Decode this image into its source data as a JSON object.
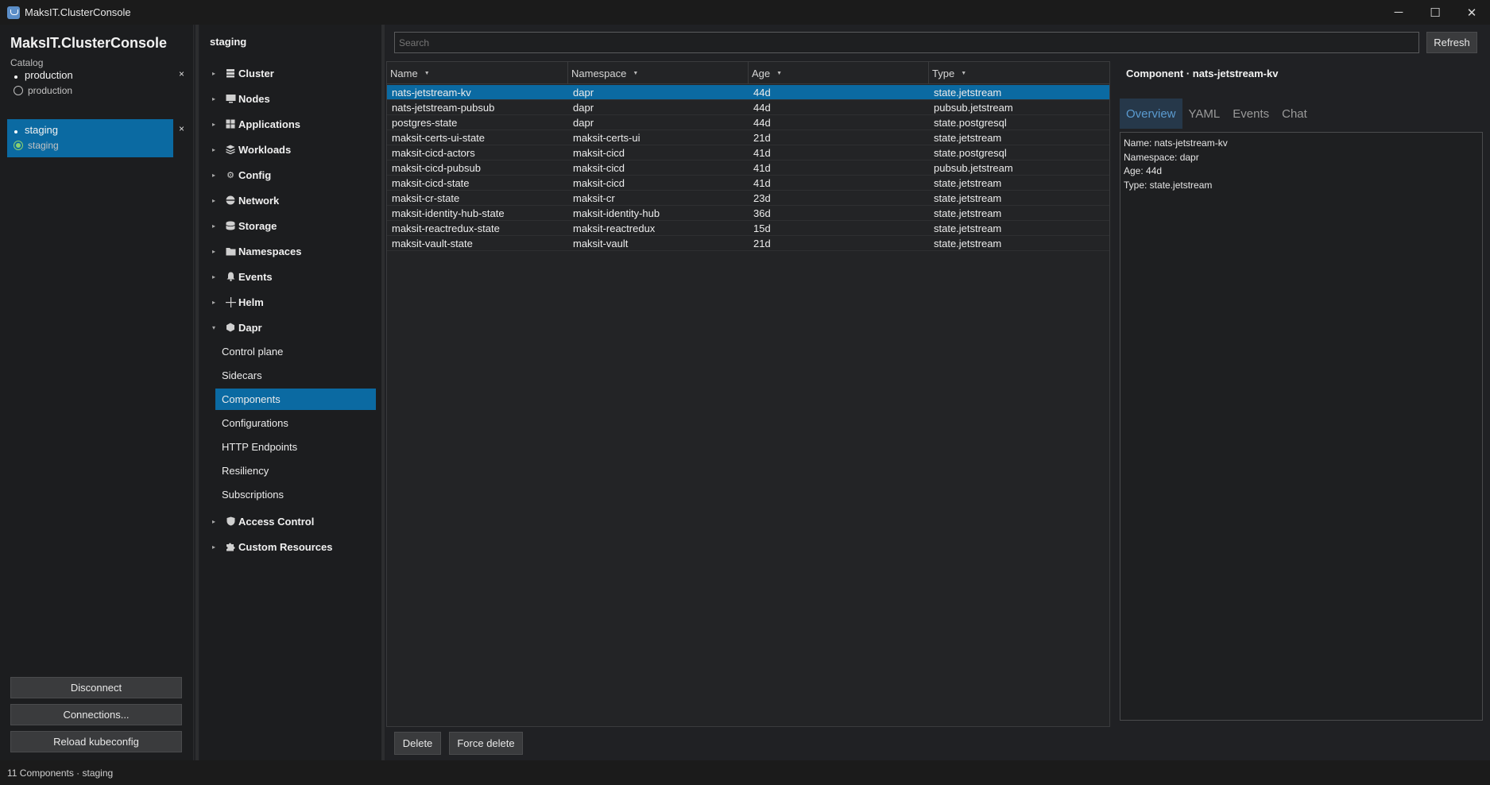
{
  "window": {
    "title": "MaksIT.ClusterConsole",
    "controls": {
      "minimize": "─",
      "maximize": "☐",
      "close": "✕"
    }
  },
  "catalog": {
    "title": "MaksIT.ClusterConsole",
    "subtitle": "Catalog",
    "connections": [
      {
        "name": "production",
        "context": "production",
        "selected": false
      },
      {
        "name": "staging",
        "context": "staging",
        "selected": true
      }
    ],
    "close_glyph": "×",
    "buttons": {
      "disconnect": "Disconnect",
      "connections": "Connections...",
      "reload": "Reload kubeconfig"
    }
  },
  "tree": {
    "header": "staging",
    "nodes": [
      {
        "label": "Cluster",
        "icon": "server-icon"
      },
      {
        "label": "Nodes",
        "icon": "monitor-icon"
      },
      {
        "label": "Applications",
        "icon": "grid-icon"
      },
      {
        "label": "Workloads",
        "icon": "layers-icon"
      },
      {
        "label": "Config",
        "icon": "gear-icon"
      },
      {
        "label": "Network",
        "icon": "network-icon"
      },
      {
        "label": "Storage",
        "icon": "database-icon"
      },
      {
        "label": "Namespaces",
        "icon": "folder-icon"
      },
      {
        "label": "Events",
        "icon": "bell-icon"
      },
      {
        "label": "Helm",
        "icon": "helm-icon"
      },
      {
        "label": "Dapr",
        "icon": "hexagon-icon"
      }
    ],
    "dapr_children": [
      "Control plane",
      "Sidecars",
      "Components",
      "Configurations",
      "HTTP Endpoints",
      "Resiliency",
      "Subscriptions"
    ],
    "selected_child": "Components",
    "after_nodes": [
      {
        "label": "Access Control",
        "icon": "shield-icon"
      },
      {
        "label": "Custom Resources",
        "icon": "puzzle-icon"
      }
    ]
  },
  "search": {
    "placeholder": "Search",
    "value": ""
  },
  "refresh_label": "Refresh",
  "grid": {
    "columns": [
      "Name",
      "Namespace",
      "Age",
      "Type"
    ],
    "sort_glyph": "▼",
    "rows": [
      [
        "nats-jetstream-kv",
        "dapr",
        "44d",
        "state.jetstream"
      ],
      [
        "nats-jetstream-pubsub",
        "dapr",
        "44d",
        "pubsub.jetstream"
      ],
      [
        "postgres-state",
        "dapr",
        "44d",
        "state.postgresql"
      ],
      [
        "maksit-certs-ui-state",
        "maksit-certs-ui",
        "21d",
        "state.jetstream"
      ],
      [
        "maksit-cicd-actors",
        "maksit-cicd",
        "41d",
        "state.postgresql"
      ],
      [
        "maksit-cicd-pubsub",
        "maksit-cicd",
        "41d",
        "pubsub.jetstream"
      ],
      [
        "maksit-cicd-state",
        "maksit-cicd",
        "41d",
        "state.jetstream"
      ],
      [
        "maksit-cr-state",
        "maksit-cr",
        "23d",
        "state.jetstream"
      ],
      [
        "maksit-identity-hub-state",
        "maksit-identity-hub",
        "36d",
        "state.jetstream"
      ],
      [
        "maksit-reactredux-state",
        "maksit-reactredux",
        "15d",
        "state.jetstream"
      ],
      [
        "maksit-vault-state",
        "maksit-vault",
        "21d",
        "state.jetstream"
      ]
    ],
    "selected_row": 0
  },
  "actions": {
    "delete": "Delete",
    "force_delete": "Force delete"
  },
  "detail": {
    "title": "Component · nats-jetstream-kv",
    "tabs": [
      "Overview",
      "YAML",
      "Events",
      "Chat"
    ],
    "selected_tab": 0,
    "lines": [
      "Name: nats-jetstream-kv",
      "Namespace: dapr",
      "Age: 44d",
      "Type: state.jetstream"
    ]
  },
  "status": "11 Components · staging",
  "colors": {
    "accent": "#0b6aa2",
    "tab_accent": "#5b9bd0",
    "ready": "#8bd16f"
  }
}
